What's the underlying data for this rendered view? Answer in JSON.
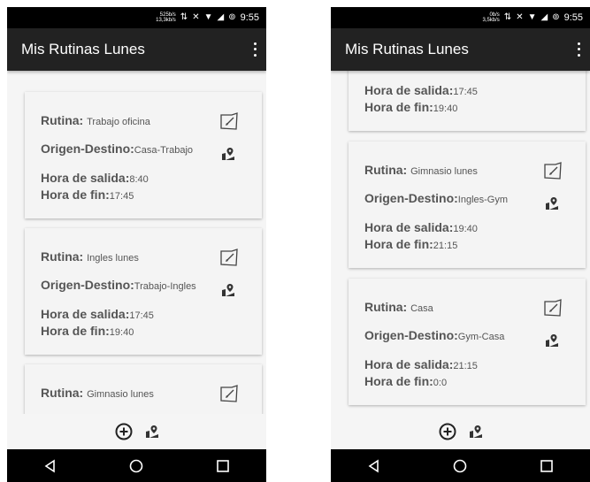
{
  "app_title": "Mis Rutinas Lunes",
  "labels": {
    "rutina": "Rutina:",
    "origen_destino": "Origen-Destino:",
    "hora_salida": "Hora de salida:",
    "hora_fin": "Hora de fin:"
  },
  "screens": [
    {
      "status": {
        "netspeed_up": "525b/s",
        "netspeed_down": "13,3kb/s",
        "time": "9:55"
      },
      "routines": [
        {
          "rutina": "Trabajo oficina",
          "origen_destino": "Casa-Trabajo",
          "hora_salida": "8:40",
          "hora_fin": "17:45"
        },
        {
          "rutina": "Ingles lunes",
          "origen_destino": "Trabajo-Ingles",
          "hora_salida": "17:45",
          "hora_fin": "19:40"
        },
        {
          "rutina": "Gimnasio lunes",
          "origen_destino": "",
          "hora_salida": "",
          "hora_fin": ""
        }
      ]
    },
    {
      "status": {
        "netspeed_up": "0b/s",
        "netspeed_down": "3,5kb/s",
        "time": "9:55"
      },
      "routines": [
        {
          "rutina": "",
          "origen_destino": "",
          "hora_salida": "17:45",
          "hora_fin": "19:40"
        },
        {
          "rutina": "Gimnasio lunes",
          "origen_destino": "Ingles-Gym",
          "hora_salida": "19:40",
          "hora_fin": "21:15"
        },
        {
          "rutina": "Casa",
          "origen_destino": "Gym-Casa",
          "hora_salida": "21:15",
          "hora_fin": "0:0"
        }
      ]
    }
  ],
  "icons": {
    "edit": "edit-note-icon",
    "map": "map-pin-icon",
    "add": "add-circle-icon",
    "back": "back-triangle-icon",
    "home": "home-circle-icon",
    "recents": "recents-square-icon"
  }
}
